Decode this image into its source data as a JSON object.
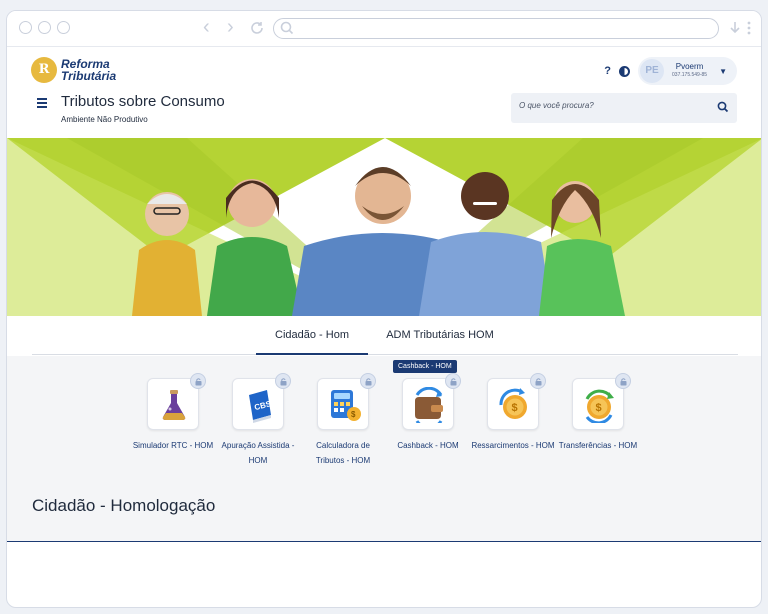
{
  "brand": {
    "logo_mark": "R",
    "line1": "Reforma",
    "line2": "Tributária"
  },
  "header": {
    "app_title": "Tributos sobre Consumo",
    "subtitle": "Ambiente Não Produtivo",
    "help_label": "?",
    "search_placeholder": "O que você procura?",
    "user": {
      "initials": "PE",
      "name": "Pvoerm",
      "document": "037.175.549-85"
    }
  },
  "tabs": [
    {
      "label": "Cidadão - Hom",
      "active": true
    },
    {
      "label": "ADM Tributárias HOM",
      "active": false
    }
  ],
  "tooltip": "Cashback - HOM",
  "apps": [
    {
      "label": "Simulador RTC - HOM",
      "icon": "flask-icon"
    },
    {
      "label": "Apuração Assistida - HOM",
      "icon": "cbs-book-icon"
    },
    {
      "label": "Calculadora de Tributos - HOM",
      "icon": "calculator-icon"
    },
    {
      "label": "Cashback - HOM",
      "icon": "wallet-cashback-icon"
    },
    {
      "label": "Ressarcimentos - HOM",
      "icon": "coin-refund-icon"
    },
    {
      "label": "Transferências - HOM",
      "icon": "coin-transfer-icon"
    }
  ],
  "section_title": "Cidadão - Homologação",
  "colors": {
    "primary": "#1b3a73",
    "hero_green": "#b5d334",
    "gold": "#e7b93f"
  }
}
